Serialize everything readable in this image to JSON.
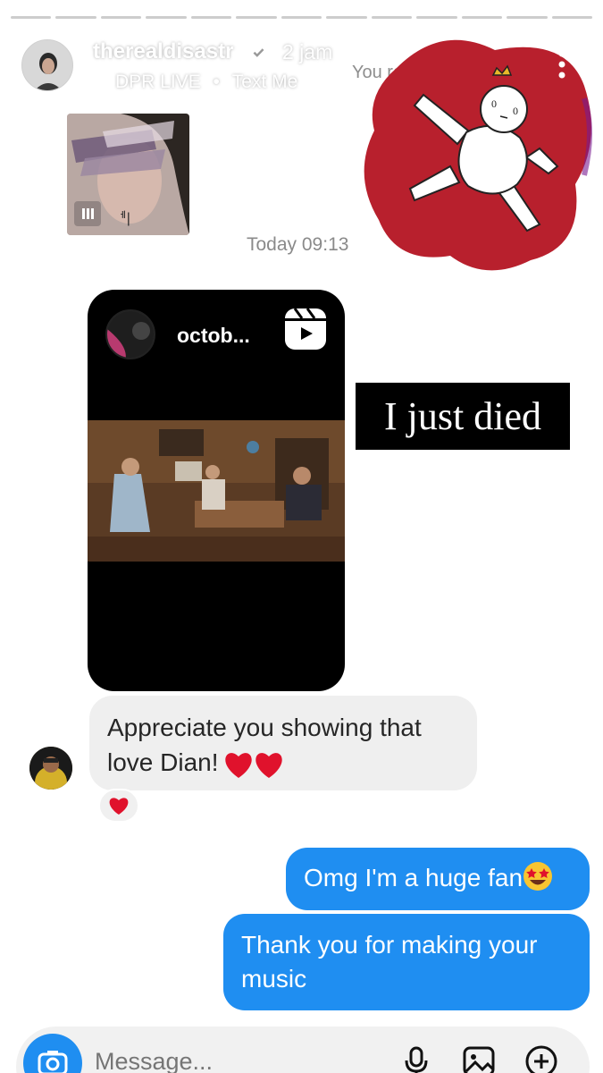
{
  "story": {
    "segments": 13,
    "username": "therealdisastr",
    "time_ago": "2 jam",
    "music_artist": "DPR LIVE",
    "separator": " • ",
    "music_title": "Text Me",
    "replied_text": "You re"
  },
  "icons": {
    "verified": "verified-badge-icon",
    "more": "more-vertical-icon",
    "reels": "reels-icon",
    "camera": "camera-icon",
    "mic": "microphone-icon",
    "gallery": "image-icon",
    "add": "plus-circle-icon"
  },
  "chat": {
    "timestamp": "Today 09:13",
    "reel_username": "octob...",
    "caption": "I just died",
    "received_message": "Appreciate you showing that love Dian!",
    "sent_1": "Omg I'm a huge fan",
    "sent_2": "Thank you for making your music"
  },
  "composer": {
    "placeholder": "Message..."
  },
  "colors": {
    "blue_bubble": "#1f8ef1",
    "grey_bubble": "#efefef",
    "sticker_red": "#b8202d",
    "heart": "#e0122c"
  }
}
